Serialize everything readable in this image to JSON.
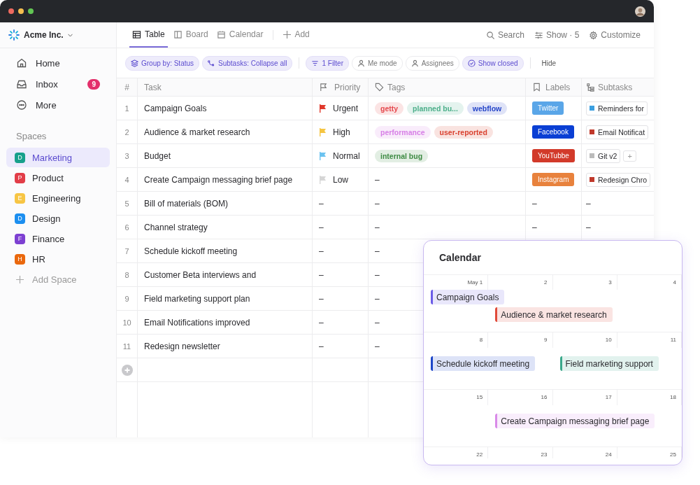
{
  "workspace": {
    "name": "Acme Inc."
  },
  "sidebar": {
    "items": [
      {
        "label": "Home"
      },
      {
        "label": "Inbox",
        "badge": "9"
      },
      {
        "label": "More"
      }
    ],
    "spaces_heading": "Spaces",
    "spaces": [
      {
        "letter": "D",
        "label": "Marketing",
        "color": "#17a08b",
        "selected": true
      },
      {
        "letter": "P",
        "label": "Product",
        "color": "#e23d48",
        "selected": false
      },
      {
        "letter": "E",
        "label": "Engineering",
        "color": "#f7c544",
        "selected": false
      },
      {
        "letter": "D",
        "label": "Design",
        "color": "#1c8ff0",
        "selected": false
      },
      {
        "letter": "F",
        "label": "Finance",
        "color": "#7d40d2",
        "selected": false
      },
      {
        "letter": "H",
        "label": "HR",
        "color": "#ea680d",
        "selected": false
      }
    ],
    "add_space": "Add Space"
  },
  "views": [
    {
      "label": "Table",
      "selected": true
    },
    {
      "label": "Board",
      "selected": false
    },
    {
      "label": "Calendar",
      "selected": false
    }
  ],
  "add_view": "Add",
  "actions": [
    {
      "label": "Search"
    },
    {
      "label": "Show · 5"
    },
    {
      "label": "Customize"
    }
  ],
  "filters": [
    {
      "label": "Group by: Status",
      "active": true
    },
    {
      "label": "Subtasks: Collapse all",
      "active": true
    },
    {
      "label": "1 Filter",
      "active": true
    },
    {
      "label": "Me mode",
      "active": false
    },
    {
      "label": "Assignees",
      "active": false
    },
    {
      "label": "Show closed",
      "active": true
    }
  ],
  "hide": "Hide",
  "table": {
    "columns": [
      {
        "label": "#"
      },
      {
        "label": "Task"
      },
      {
        "label": "Priority"
      },
      {
        "label": "Tags"
      },
      {
        "label": "Labels"
      },
      {
        "label": "Subtasks"
      }
    ],
    "rows": [
      {
        "num": "1",
        "task": "Campaign Goals",
        "priority": {
          "label": "Urgent",
          "color": "#e0382b"
        },
        "tags": [
          {
            "label": "getty",
            "color": "#e5484d"
          },
          {
            "label": "planned bu...",
            "color": "#4caf8a"
          },
          {
            "label": "webflow",
            "color": "#2545c8"
          }
        ],
        "label": {
          "label": "Twitter",
          "color": "#5aa6e8"
        },
        "subtasks": [
          {
            "label": "Reminders for",
            "color": "#3b9fe0"
          }
        ]
      },
      {
        "num": "2",
        "task": "Audience & market research",
        "priority": {
          "label": "High",
          "color": "#f5c542"
        },
        "tags": [
          {
            "label": "performance",
            "color": "#d77fe6"
          },
          {
            "label": "user-reported",
            "color": "#d9412f"
          }
        ],
        "label": {
          "label": "Facebook",
          "color": "#0a3fd4"
        },
        "subtasks": [
          {
            "label": "Email Notificat",
            "color": "#c0392b"
          }
        ]
      },
      {
        "num": "3",
        "task": "Budget",
        "priority": {
          "label": "Normal",
          "color": "#6cc3f0"
        },
        "tags": [
          {
            "label": "internal bug",
            "color": "#3d8a43"
          }
        ],
        "label": {
          "label": "YouTubbe",
          "color": "#d23a2a"
        },
        "subtasks": [
          {
            "label": "Git v2",
            "color": "#bbbbbb"
          }
        ],
        "add_subtask": "+"
      },
      {
        "num": "4",
        "task": "Create Campaign messaging brief page",
        "priority": {
          "label": "Low",
          "color": "#d6d6d6"
        },
        "tags_text": "–",
        "label": {
          "label": "Instagram",
          "color": "#e8823d"
        },
        "subtasks": [
          {
            "label": "Redesign Chro",
            "color": "#c0392b"
          }
        ]
      },
      {
        "num": "5",
        "task": "Bill of materials (BOM)",
        "priority": {
          "label": "–"
        },
        "tags_text": "–",
        "label_text": "–",
        "subtasks_text": "–"
      },
      {
        "num": "6",
        "task": "Channel strategy",
        "priority": {
          "label": "–"
        },
        "tags_text": "–",
        "label_text": "–",
        "subtasks_text": "–"
      },
      {
        "num": "7",
        "task": "Schedule kickoff meeting",
        "priority": {
          "label": "–"
        },
        "tags_text": "–"
      },
      {
        "num": "8",
        "task": "Customer Beta interviews and",
        "priority": {
          "label": "–"
        },
        "tags_text": "–"
      },
      {
        "num": "9",
        "task": "Field marketing support plan",
        "priority": {
          "label": "–"
        },
        "tags_text": "–"
      },
      {
        "num": "10",
        "task": "Email Notifications improved",
        "priority": {
          "label": "–"
        },
        "tags_text": "–"
      },
      {
        "num": "11",
        "task": "Redesign newsletter",
        "priority": {
          "label": "–"
        },
        "tags_text": "–"
      }
    ]
  },
  "calendar": {
    "title": "Calendar",
    "weeks": [
      {
        "days": [
          {
            "label": "May 1",
            "events": [
              {
                "label": "Campaign Goals",
                "color": "#6b5ce7"
              }
            ]
          },
          {
            "label": "2",
            "events": [
              {
                "label": "Audience & market research",
                "color": "#e04a3a"
              }
            ]
          },
          {
            "label": "3"
          },
          {
            "label": "4"
          }
        ]
      },
      {
        "days": [
          {
            "label": "8",
            "events": [
              {
                "label": "Schedule kickoff meeting",
                "color": "#1d46c8"
              }
            ]
          },
          {
            "label": "9"
          },
          {
            "label": "10",
            "events": [
              {
                "label": "Field marketing support",
                "color": "#3aa88a"
              }
            ]
          },
          {
            "label": "11"
          }
        ]
      },
      {
        "days": [
          {
            "label": "15"
          },
          {
            "label": "16",
            "events": [
              {
                "label": "Create Campaign messaging brief page",
                "color": "#d98ae8"
              }
            ]
          },
          {
            "label": "17"
          },
          {
            "label": "18"
          }
        ]
      },
      {
        "days": [
          {
            "label": "22"
          },
          {
            "label": "23"
          },
          {
            "label": "24"
          },
          {
            "label": "25"
          }
        ]
      }
    ]
  }
}
